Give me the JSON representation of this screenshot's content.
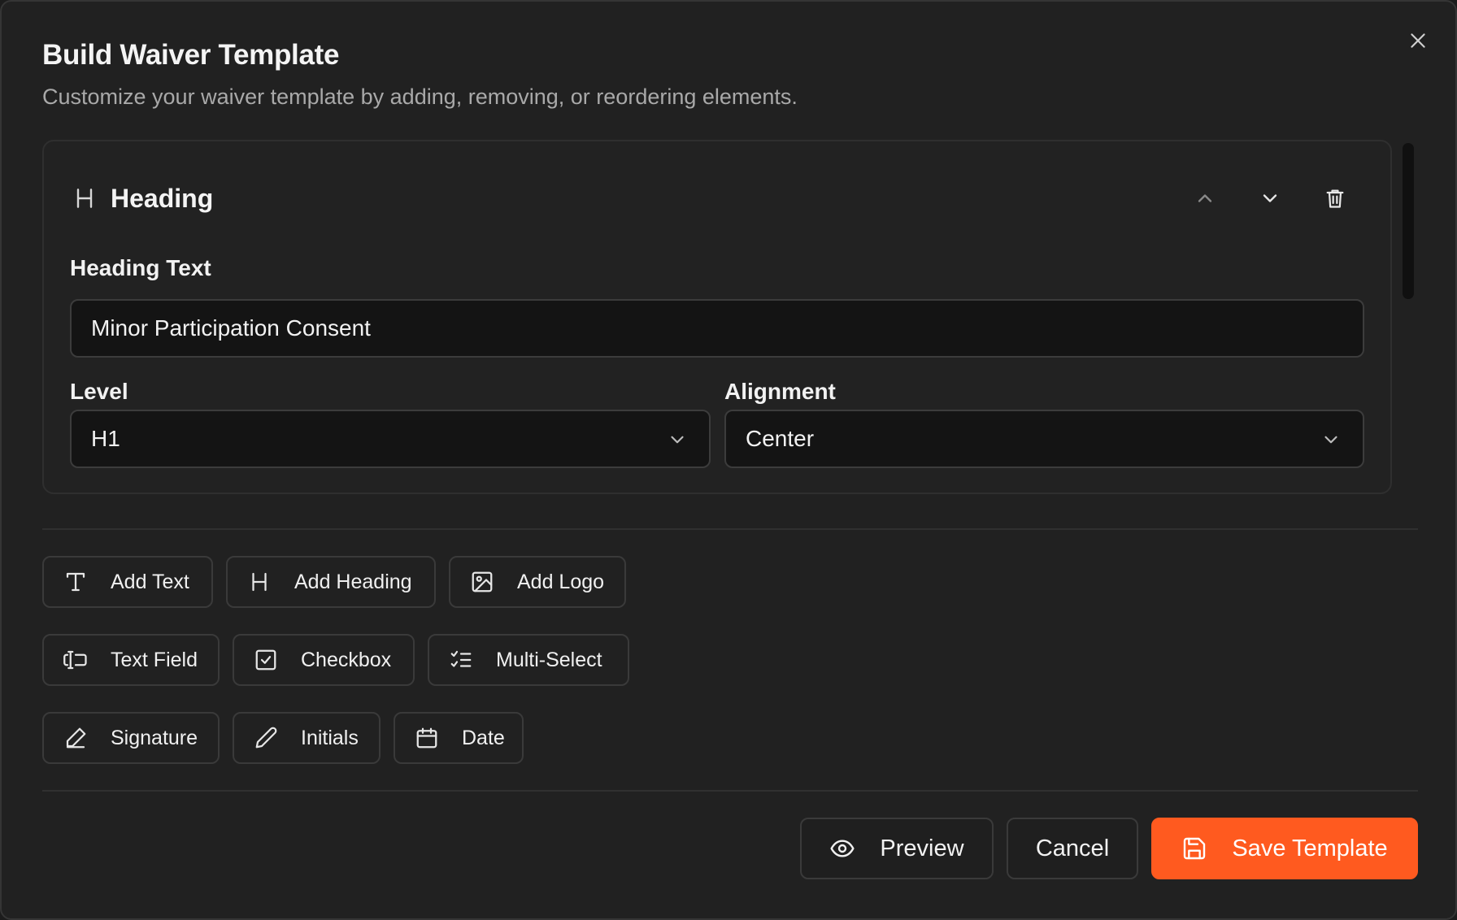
{
  "dialog": {
    "title": "Build Waiver Template",
    "subtitle": "Customize your waiver template by adding, removing, or reordering elements."
  },
  "element_card": {
    "type_icon": "heading-icon",
    "title": "Heading",
    "fields": {
      "heading_text_label": "Heading Text",
      "heading_text_value": "Minor Participation Consent",
      "level_label": "Level",
      "level_value": "H1",
      "alignment_label": "Alignment",
      "alignment_value": "Center"
    },
    "actions": {
      "move_up_icon": "chevron-up-icon",
      "move_down_icon": "chevron-down-icon",
      "delete_icon": "trash-icon"
    }
  },
  "toolbar": {
    "add_text": "Add Text",
    "add_heading": "Add Heading",
    "add_logo": "Add Logo",
    "text_field": "Text Field",
    "checkbox": "Checkbox",
    "multi_select": "Multi-Select",
    "signature": "Signature",
    "initials": "Initials",
    "date": "Date"
  },
  "footer": {
    "preview_label": "Preview",
    "cancel_label": "Cancel",
    "save_label": "Save Template"
  },
  "colors": {
    "background": "#212121",
    "accent": "#ff5a1f",
    "input_bg": "#141414",
    "border": "#3a3a3a",
    "muted_text": "#a9a9a9"
  }
}
